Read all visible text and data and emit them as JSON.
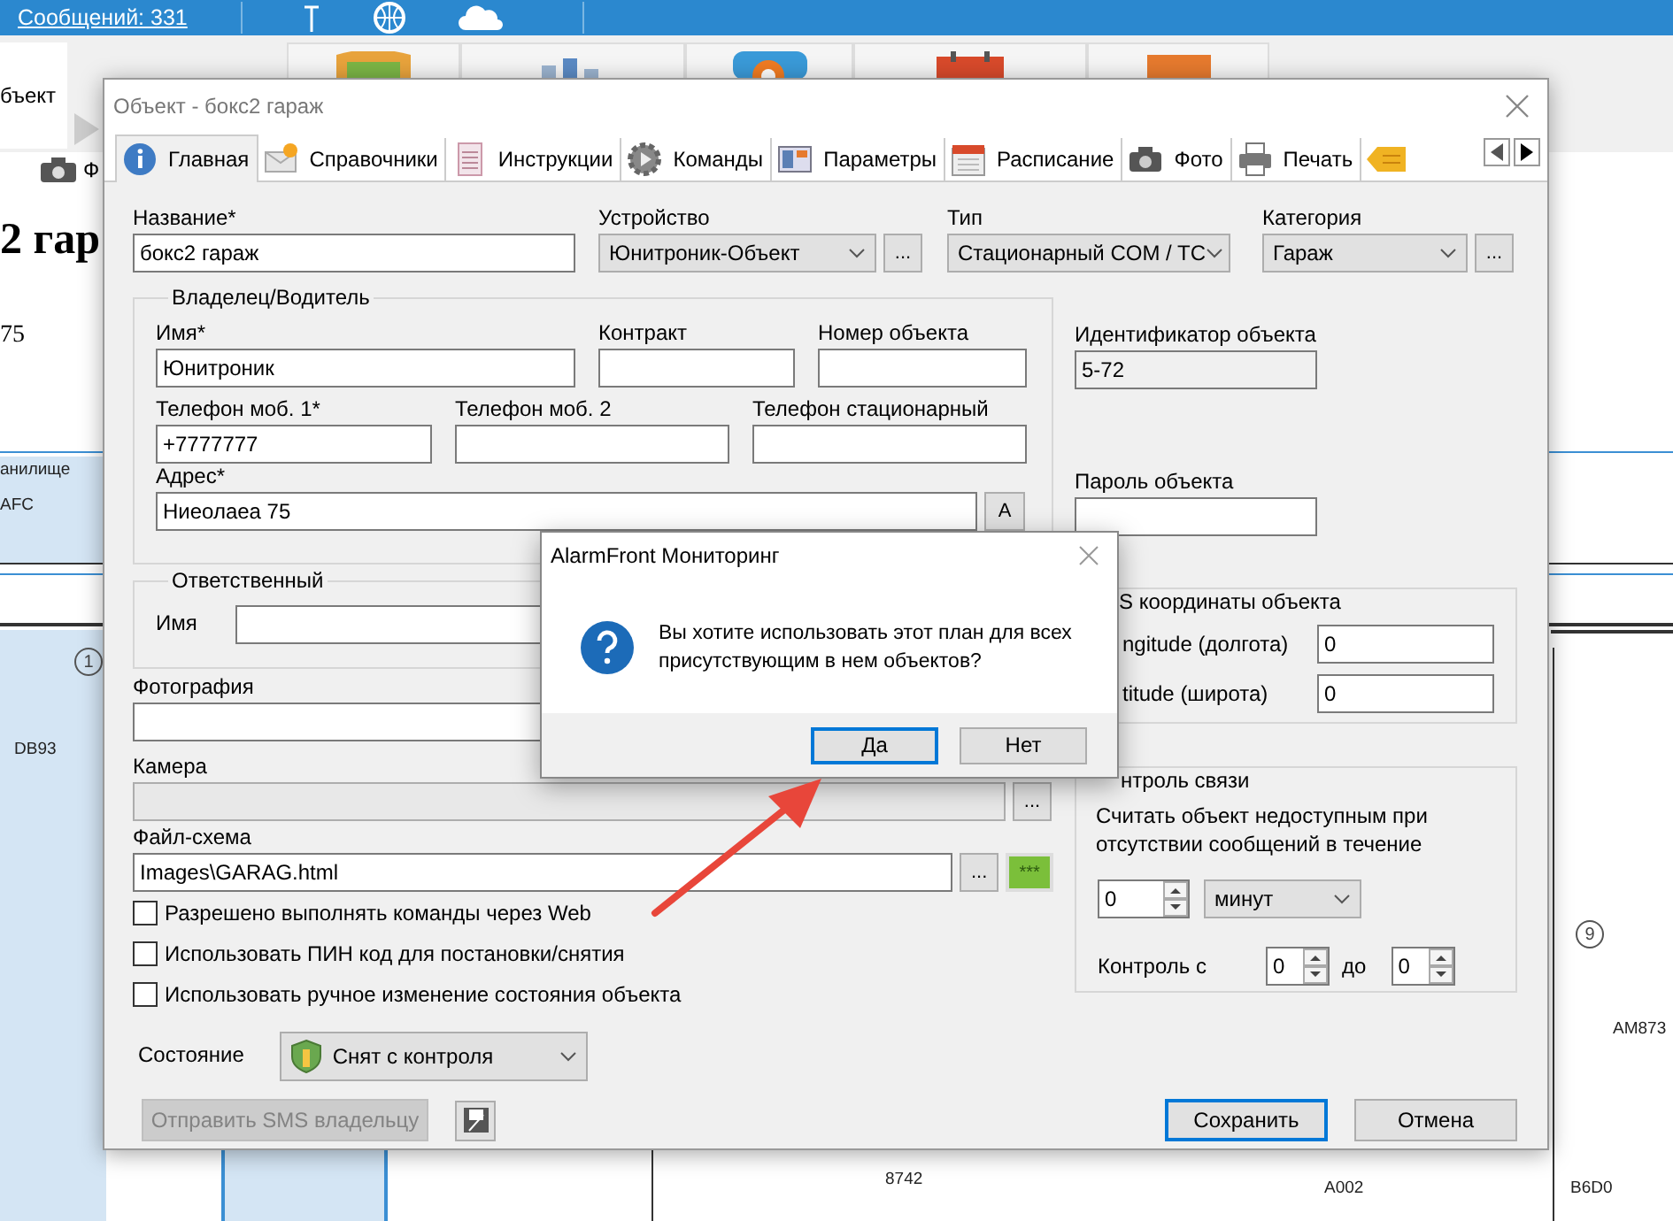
{
  "app": {
    "messages_link": "Сообщений: 331",
    "object_tab": "бъект",
    "side_tab": "Ф",
    "page_heading": "2 гар",
    "page_line": "75",
    "plan_labels": [
      {
        "text": "анилище"
      },
      {
        "text": "AFC"
      },
      {
        "text": "DB93"
      },
      {
        "text": "AM873"
      },
      {
        "text": "8742"
      },
      {
        "text": "A002"
      },
      {
        "text": "B6D0"
      }
    ],
    "zone_numbers": [
      "1",
      "9"
    ]
  },
  "dialog": {
    "title": "Объект - бокс2 гараж",
    "tabs": [
      {
        "label": "Главная",
        "selected": true
      },
      {
        "label": "Справочники",
        "selected": false
      },
      {
        "label": "Инструкции",
        "selected": false
      },
      {
        "label": "Команды",
        "selected": false
      },
      {
        "label": "Параметры",
        "selected": false
      },
      {
        "label": "Расписание",
        "selected": false
      },
      {
        "label": "Фото",
        "selected": false
      },
      {
        "label": "Печать",
        "selected": false
      }
    ],
    "top_fields": [
      {
        "label": "Название*",
        "kind": "text",
        "value": "бокс2 гараж"
      },
      {
        "label": "Устройство",
        "kind": "select",
        "value": "Юнитроник-Объект",
        "more": "..."
      },
      {
        "label": "Тип",
        "kind": "select",
        "value": "Стационарный COM / TC"
      },
      {
        "label": "Категория",
        "kind": "select",
        "value": "Гараж",
        "more": "..."
      }
    ],
    "owner": {
      "title": "Владелец/Водитель",
      "rows": [
        [
          {
            "label": "Имя*",
            "value": "Юнитроник"
          },
          {
            "label": "Контракт"
          },
          {
            "label": "Номер объекта"
          }
        ],
        [
          {
            "label": "Телефон моб. 1*",
            "value": "+7777777"
          },
          {
            "label": "Телефон моб. 2"
          },
          {
            "label": "Телефон стационарный"
          }
        ]
      ],
      "address_label": "Адрес*",
      "address": "Ниеолаеа 75",
      "address_button": "A"
    },
    "responsible": {
      "title": "Ответственный",
      "name_label": "Имя"
    },
    "photo_label": "Фотография",
    "camera": {
      "label": "Камера",
      "more": "..."
    },
    "scheme": {
      "label": "Файл-схема",
      "value": "Images\\GARAG.html",
      "more": "...",
      "pin": "***"
    },
    "options": [
      {
        "label": "Разрешено выполнять команды через Web",
        "checked": false
      },
      {
        "label": "Использовать ПИН код для постановки/снятия",
        "checked": false
      },
      {
        "label": "Использовать ручное изменение состояния объекта",
        "checked": false
      }
    ],
    "state": {
      "label": "Состояние",
      "value": "Снят с контроля"
    },
    "sms_button": {
      "label": "Отправить SMS владельцу",
      "disabled": true
    },
    "save_button": "Сохранить",
    "cancel_button": "Отмена",
    "id_label": "Идентификатор объекта",
    "id_value": "5-72",
    "password_label": "Пароль объекта",
    "gps": {
      "title": "S координаты объекта",
      "rows": [
        {
          "label": "ngitude (долгота)",
          "value": "0"
        },
        {
          "label": "titude (широта)",
          "value": "0"
        }
      ]
    },
    "link_control": {
      "title": "нтроль связи",
      "text": "Считать объект недоступным при отсутствии сообщений в течение",
      "period": "0",
      "unit": "минут",
      "from_label": "Контроль с",
      "from": "0",
      "to_label": "до",
      "to": "0"
    }
  },
  "message_box": {
    "title": "AlarmFront Мониторинг",
    "text": "Вы хотите использовать этот план для всех присутствующим в нем объектов?",
    "buttons": [
      {
        "label": "Да",
        "selected": true
      },
      {
        "label": "Нет",
        "selected": false
      }
    ]
  }
}
